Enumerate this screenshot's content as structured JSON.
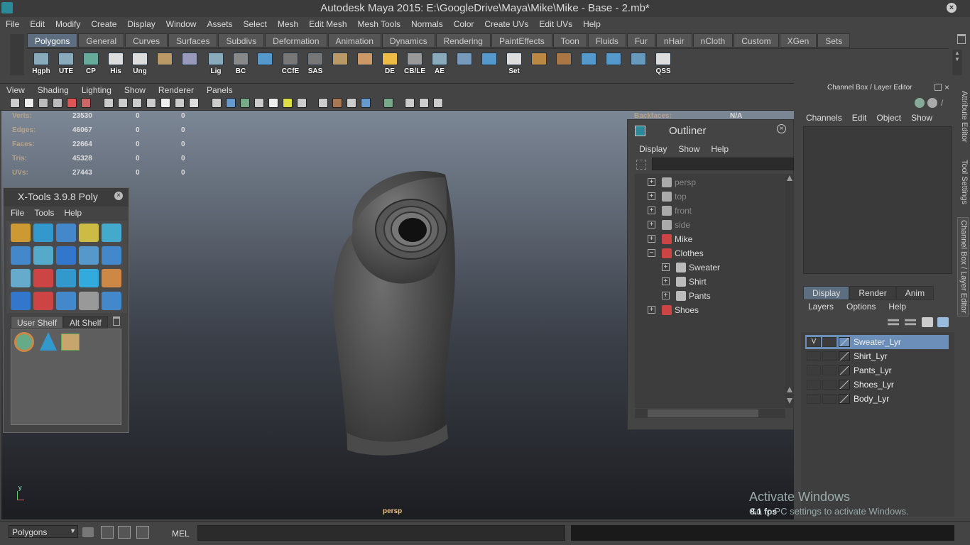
{
  "window": {
    "title": "Autodesk Maya 2015: E:\\GoogleDrive\\Maya\\Mike\\Mike - Base - 2.mb*",
    "close_icon": "close-icon"
  },
  "menubar": [
    "File",
    "Edit",
    "Modify",
    "Create",
    "Display",
    "Window",
    "Assets",
    "Select",
    "Mesh",
    "Edit Mesh",
    "Mesh Tools",
    "Normals",
    "Color",
    "Create UVs",
    "Edit UVs",
    "Help"
  ],
  "shelf_tabs": [
    "Polygons",
    "General",
    "Curves",
    "Surfaces",
    "Subdivs",
    "Deformation",
    "Animation",
    "Dynamics",
    "Rendering",
    "PaintEffects",
    "Toon",
    "Fluids",
    "Fur",
    "nHair",
    "nCloth",
    "Custom",
    "XGen",
    "Sets"
  ],
  "shelf_buttons": [
    "Hgph",
    "UTE",
    "CP",
    "His",
    "Ung",
    "",
    "",
    "Lig",
    "BC",
    "",
    "CCfE",
    "SAS",
    "",
    "",
    "DE",
    "CB/LE",
    "AE",
    "",
    "",
    "Set",
    "",
    "",
    "",
    "",
    "",
    "QSS"
  ],
  "viewport": {
    "menu": [
      "View",
      "Shading",
      "Lighting",
      "Show",
      "Renderer",
      "Panels"
    ],
    "hud": [
      {
        "label": "Verts:",
        "v": "23530",
        "a": "0",
        "b": "0"
      },
      {
        "label": "Edges:",
        "v": "46067",
        "a": "0",
        "b": "0"
      },
      {
        "label": "Faces:",
        "v": "22664",
        "a": "0",
        "b": "0"
      },
      {
        "label": "Tris:",
        "v": "45328",
        "a": "0",
        "b": "0"
      },
      {
        "label": "UVs:",
        "v": "27443",
        "a": "0",
        "b": "0"
      }
    ],
    "backfaces_label": "Backfaces:",
    "backfaces_value": "N/A",
    "camera": "persp",
    "fps": "8.1 fps",
    "axis_label": "y"
  },
  "xtools": {
    "title": "X-Tools 3.9.8 Poly",
    "menu": [
      "File",
      "Tools",
      "Help"
    ],
    "tabs": [
      "User Shelf",
      "Alt Shelf"
    ]
  },
  "outliner": {
    "title": "Outliner",
    "menu": [
      "Display",
      "Show",
      "Help"
    ],
    "items": [
      {
        "name": "persp",
        "type": "camera",
        "dim": true,
        "level": 0,
        "exp": "+"
      },
      {
        "name": "top",
        "type": "camera",
        "dim": true,
        "level": 0,
        "exp": "+"
      },
      {
        "name": "front",
        "type": "camera",
        "dim": true,
        "level": 0,
        "exp": "+"
      },
      {
        "name": "side",
        "type": "camera",
        "dim": true,
        "level": 0,
        "exp": "+"
      },
      {
        "name": "Mike",
        "type": "transform",
        "dim": false,
        "level": 0,
        "exp": "+"
      },
      {
        "name": "Clothes",
        "type": "transform",
        "dim": false,
        "level": 0,
        "exp": "−"
      },
      {
        "name": "Sweater",
        "type": "mesh",
        "dim": false,
        "level": 1,
        "exp": "+"
      },
      {
        "name": "Shirt",
        "type": "mesh",
        "dim": false,
        "level": 1,
        "exp": "+"
      },
      {
        "name": "Pants",
        "type": "mesh",
        "dim": false,
        "level": 1,
        "exp": "+"
      },
      {
        "name": "Shoes",
        "type": "transform",
        "dim": false,
        "level": 0,
        "exp": "+"
      }
    ]
  },
  "channel_box": {
    "title": "Channel Box / Layer Editor",
    "menu": [
      "Channels",
      "Edit",
      "Object",
      "Show"
    ]
  },
  "layer_editor": {
    "tabs": [
      "Display",
      "Render",
      "Anim"
    ],
    "menu": [
      "Layers",
      "Options",
      "Help"
    ],
    "layers": [
      {
        "name": "Sweater_Lyr",
        "v": "V",
        "selected": true
      },
      {
        "name": "Shirt_Lyr",
        "v": "",
        "selected": false
      },
      {
        "name": "Pants_Lyr",
        "v": "",
        "selected": false
      },
      {
        "name": "Shoes_Lyr",
        "v": "",
        "selected": false
      },
      {
        "name": "Body_Lyr",
        "v": "",
        "selected": false
      }
    ]
  },
  "side_tabs": [
    "Attribute Editor",
    "Tool Settings",
    "Channel Box / Layer Editor"
  ],
  "statusbar": {
    "menu_set": "Polygons",
    "command_type": "MEL",
    "watermark_title": "Activate Windows",
    "watermark_sub": "Go to PC settings to activate Windows."
  },
  "colors": {
    "accent": "#5d6e80",
    "selection": "#6b8fb8",
    "hud_label": "#b7a38a"
  }
}
